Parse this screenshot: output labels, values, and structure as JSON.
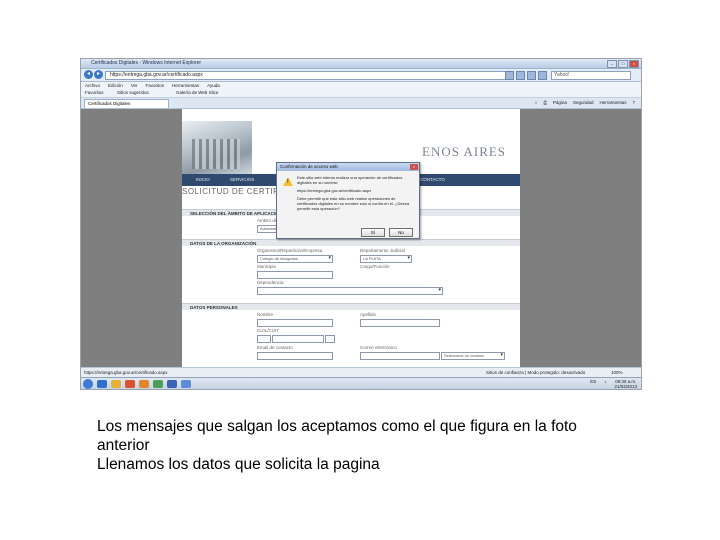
{
  "browser": {
    "window_title": "Certificados Digitales - Windows Internet Explorer",
    "address": "https://entrega.gba.gov.ar/certificado.aspx",
    "search_placeholder": "Yahoo!",
    "menu": [
      "Archivo",
      "Edición",
      "Ver",
      "Favoritos",
      "Herramientas",
      "Ayuda"
    ],
    "favorites": [
      "Favoritos",
      "Sitios sugeridos",
      "Galería de Web Slice"
    ],
    "tab": "Certificados Digitales",
    "command_bar": [
      "Página",
      "Seguridad",
      "Herramientas"
    ],
    "status_text": "https://entrega.gba.gov.ar/certificado.aspx",
    "status_zone": "Sitios de confianza | Modo protegido: desactivado",
    "status_zoom": "100%"
  },
  "site": {
    "logo_text": "ENOS AIRES",
    "nav": [
      "INICIO",
      "SERVICIOS",
      "LEGISLACIÓN",
      "CONTACTO"
    ],
    "form_title": "SOLICITUD DE CERTIFICADO NUEVO",
    "sections": {
      "ambito": "SELECCIÓN DEL ÁMBITO DE APLICACIÓN",
      "organizacion": "DATOS DE LA ORGANIZACIÓN",
      "personales": "DATOS PERSONALES"
    },
    "fields": {
      "ambito_label": "Ámbito de aplicación",
      "ambito_value": "Administración Pública",
      "organismo_label": "Organismo/Repartición/Empresa",
      "organismo_value": "Colegio de Abogados",
      "departamento_label": "Departamento Judicial",
      "departamento_value": "LA PLATA",
      "municipio_label": "Municipio",
      "cargo_label": "Cargo/Función",
      "dependencia_label": "Dependencia",
      "nombre_label": "Nombre",
      "apellido_label": "Apellido",
      "cuil_label": "CUIL/CUIT",
      "email_label": "Email de contacto",
      "correo_label": "Correo electrónico",
      "correo_select": "Seleccione un dominio"
    }
  },
  "dialog": {
    "title": "Confirmación de acceso web",
    "line1": "Este sitio web intenta realizar una operación de certificados digitales en su nombre:",
    "line2": "https://entrega.gba.gov.ar/certificado.aspx",
    "line3": "Debe permitir que este sitio web realice operaciones de certificados digitales en su nombre solo si confía en él. ¿Desea permitir esta operación?",
    "yes": "Sí",
    "no": "No"
  },
  "taskbar": {
    "language": "ES",
    "time": "09:30 a.m.",
    "date": "21/04/2013"
  },
  "caption": {
    "line1": "Los mensajes que salgan los aceptamos como el que figura en la foto",
    "line2": "anterior",
    "line3": "Llenamos los datos que solicita la pagina"
  }
}
